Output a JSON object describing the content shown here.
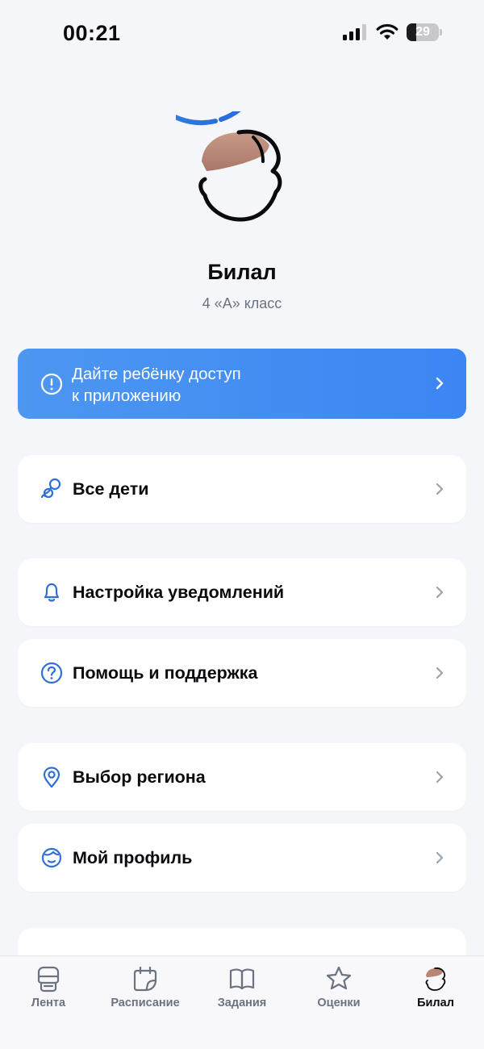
{
  "status_bar": {
    "time": "00:21",
    "battery": "29",
    "icons": [
      "signal-icon",
      "wifi-icon",
      "battery-icon"
    ]
  },
  "profile": {
    "name": "Билал",
    "class": "4 «А» класс",
    "avatar_icon": "child-avatar-icon"
  },
  "banner": {
    "line1": "Дайте ребёнку доступ",
    "line2": "к приложению",
    "icon": "alert-circle-icon"
  },
  "menu": {
    "all_children": "Все дети",
    "notifications": "Настройка уведомлений",
    "help": "Помощь и поддержка",
    "region": "Выбор региона",
    "my_profile": "Мой профиль"
  },
  "tabs": {
    "feed": "Лента",
    "schedule": "Расписание",
    "tasks": "Задания",
    "grades": "Оценки",
    "profile": "Билал"
  },
  "colors": {
    "accent": "#3b86f3",
    "icon_blue": "#2f6fd6",
    "background": "#f5f6f9",
    "card": "#ffffff",
    "muted": "#6b7280"
  }
}
